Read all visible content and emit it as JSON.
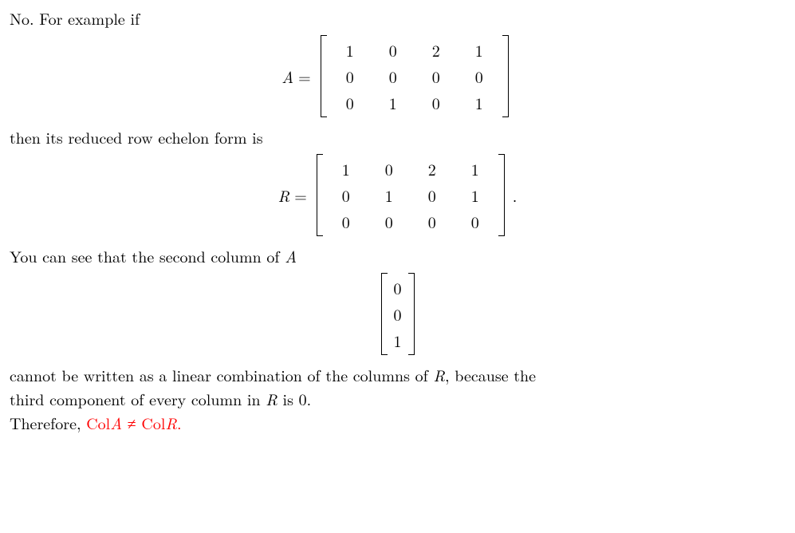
{
  "text": {
    "line1": "No. For example if",
    "line2": "then its reduced row echelon form is",
    "line3_a": "You can see that the second column of ",
    "line3_b": "A",
    "line4_a": "cannot be written as a linear combination of the columns of ",
    "line4_b": "R",
    "line4_c": ", because the",
    "line5_a": "third component of every column in ",
    "line5_b": "R",
    "line5_c": " is 0.",
    "line6_a": "Therefore, ",
    "line6_red": "Col",
    "line6_A": "A",
    "line6_neq": " ≠ ",
    "line6_red2": "Col",
    "line6_R": "R",
    "line6_d": "."
  },
  "eq": {
    "A_lhs": "A",
    "R_lhs": "R",
    "eq_sign": "=",
    "period": "."
  },
  "matrixA": {
    "rows": [
      [
        "1",
        "0",
        "2",
        "1"
      ],
      [
        "0",
        "0",
        "0",
        "0"
      ],
      [
        "0",
        "1",
        "0",
        "1"
      ]
    ]
  },
  "matrixR": {
    "rows": [
      [
        "1",
        "0",
        "2",
        "1"
      ],
      [
        "0",
        "1",
        "0",
        "1"
      ],
      [
        "0",
        "0",
        "0",
        "0"
      ]
    ]
  },
  "colVec": {
    "rows": [
      [
        "0"
      ],
      [
        "0"
      ],
      [
        "1"
      ]
    ]
  }
}
